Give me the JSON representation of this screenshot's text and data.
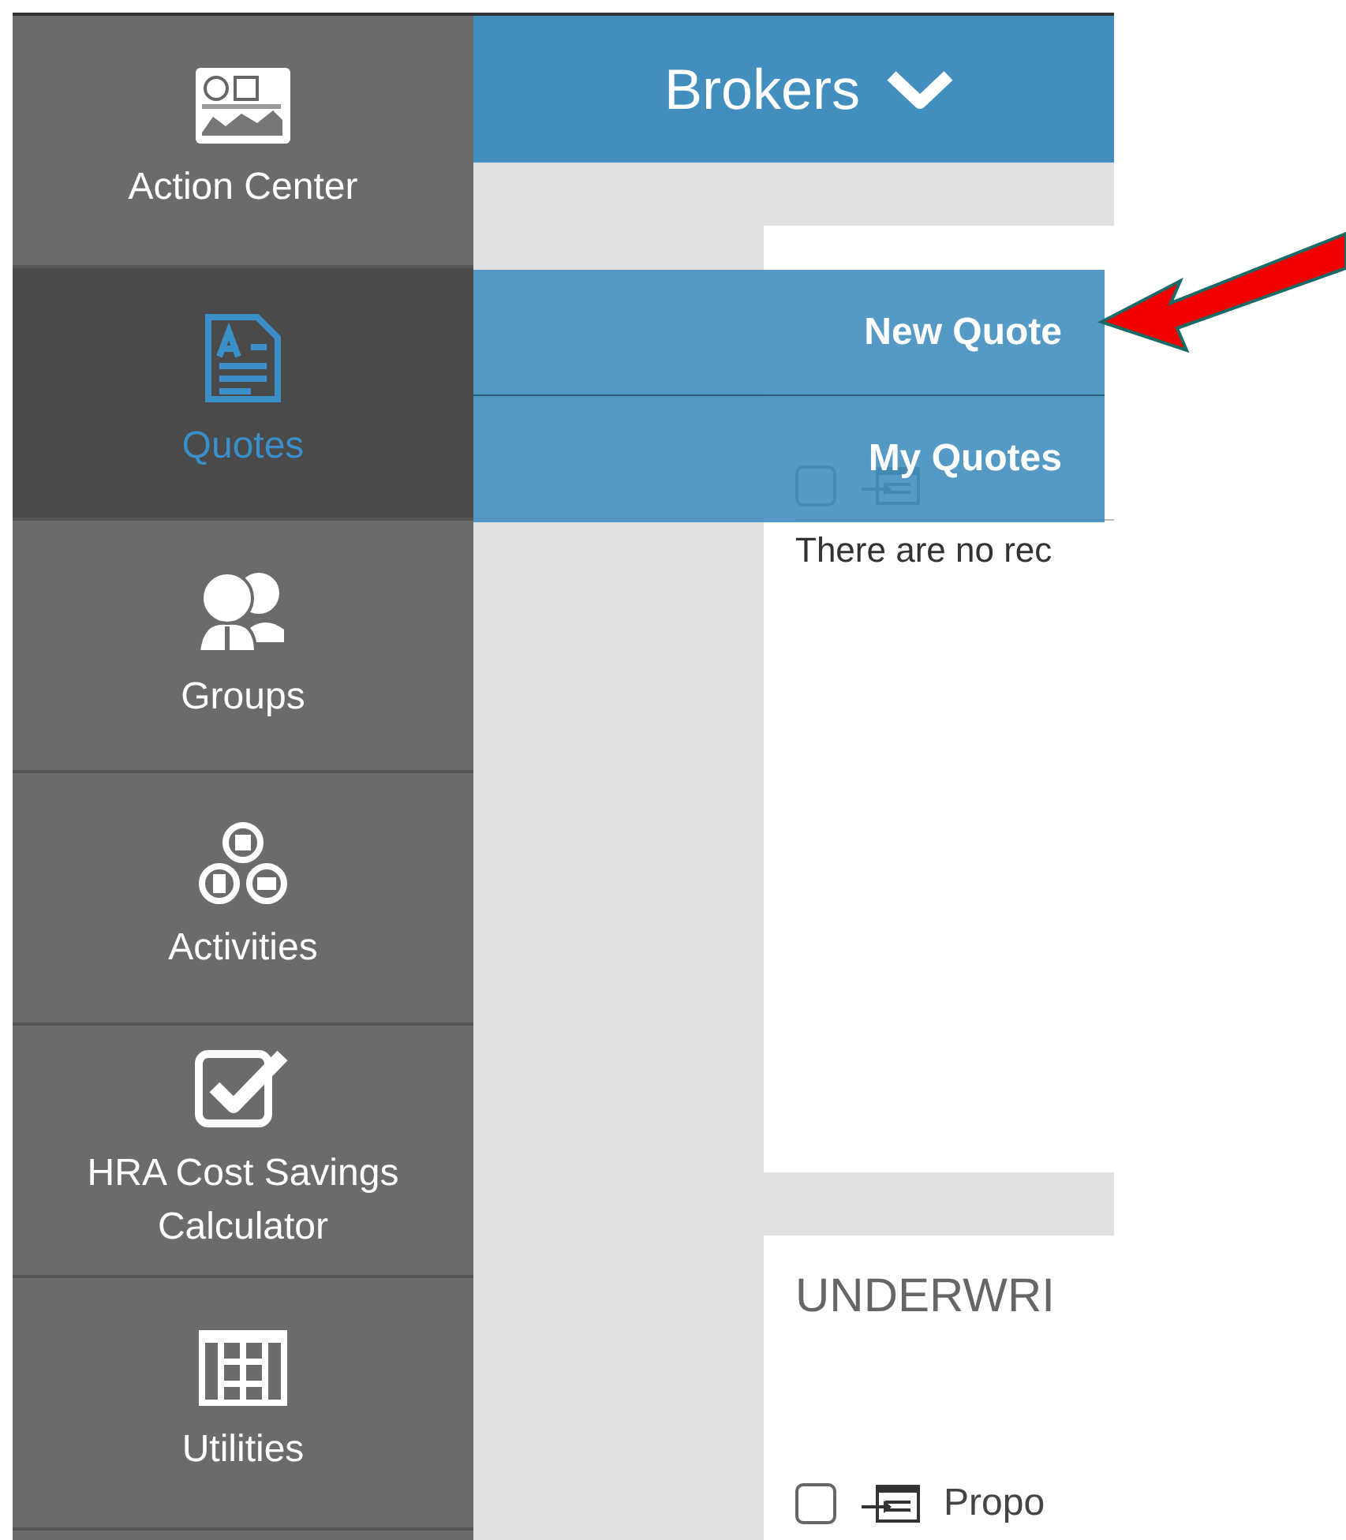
{
  "header": {
    "title": "Brokers"
  },
  "sidebar": {
    "items": [
      {
        "label": "Action Center",
        "kind": "dashboard",
        "selected": false
      },
      {
        "label": "Quotes",
        "kind": "document",
        "selected": true
      },
      {
        "label": "Groups",
        "kind": "people",
        "selected": false
      },
      {
        "label": "Activities",
        "kind": "activities",
        "selected": false
      },
      {
        "label": "HRA Cost Savings Calculator",
        "kind": "checkbox",
        "selected": false
      },
      {
        "label": "Utilities",
        "kind": "grid",
        "selected": false
      }
    ]
  },
  "dropdown": {
    "items": [
      "New Quote",
      "My Quotes"
    ]
  },
  "news_card": {
    "select_all_checked": false,
    "empty_message": "There are no rec"
  },
  "underwriting_card": {
    "title": "UNDERWRI",
    "rows": [
      {
        "label": "Propo",
        "checked": false
      }
    ]
  }
}
